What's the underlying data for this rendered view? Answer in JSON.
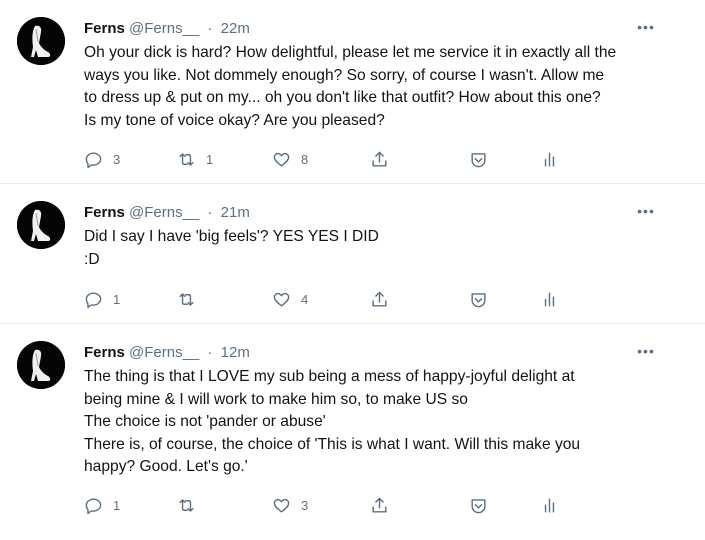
{
  "tweets": [
    {
      "name": "Ferns",
      "handle": "@Ferns__",
      "time": "22m",
      "lines": [
        "Oh your dick is hard? How delightful, please let me service it in exactly all the",
        "ways you like. Not dommely enough? So sorry, of course I wasn't. Allow me",
        "to dress up & put on my... oh you don't like that outfit? How about this one?",
        "Is my tone of voice okay? Are you pleased?"
      ],
      "reply_count": "3",
      "retweet_count": "1",
      "like_count": "8"
    },
    {
      "name": "Ferns",
      "handle": "@Ferns__",
      "time": "21m",
      "lines": [
        "Did I say I have 'big feels'? YES YES I DID",
        ":D"
      ],
      "reply_count": "1",
      "retweet_count": "",
      "like_count": "4"
    },
    {
      "name": "Ferns",
      "handle": "@Ferns__",
      "time": "12m",
      "lines": [
        "The thing is that I LOVE my sub being a mess of happy-joyful delight at",
        "being mine & I will work to make him so, to make US so",
        "The choice is not 'pander or abuse'",
        "There is, of course, the choice of 'This is what I want. Will this make you",
        "happy? Good. Let's go.'"
      ],
      "reply_count": "1",
      "retweet_count": "",
      "like_count": "3"
    }
  ],
  "ui": {
    "separator": "·",
    "more": "•••"
  },
  "icons": {
    "reply": "reply-icon",
    "retweet": "retweet-icon",
    "like": "heart-icon",
    "share": "share-icon",
    "tip": "tip-icon",
    "analytics": "analytics-icon",
    "more": "more-icon",
    "avatar": "avatar-image"
  },
  "colors": {
    "text": "#0f1419",
    "secondary": "#5b7083",
    "divider": "#e6ecf0"
  }
}
